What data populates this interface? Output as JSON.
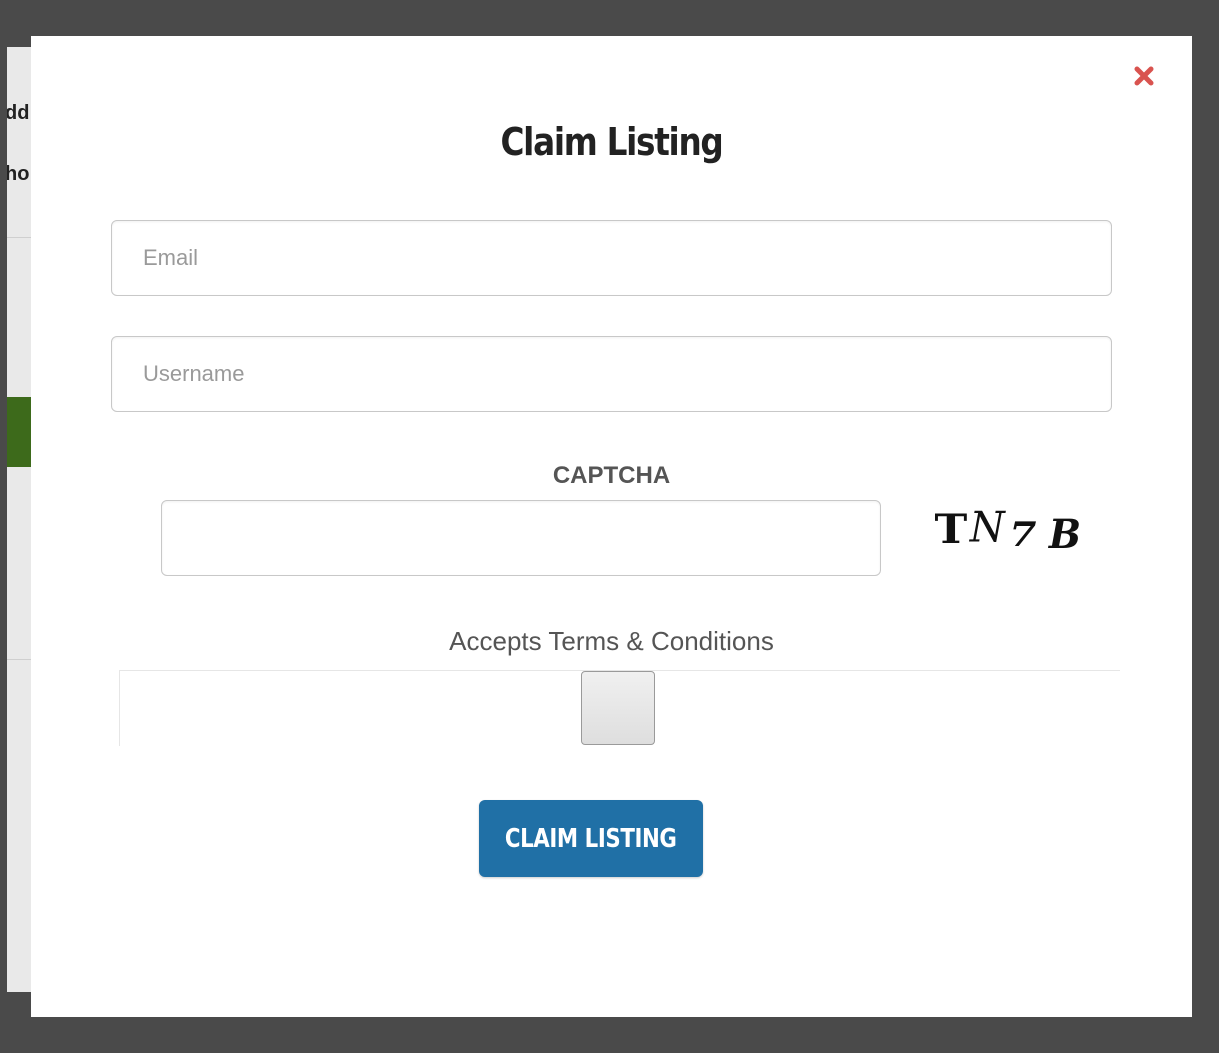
{
  "background": {
    "text_line_1": "dd",
    "text_line_2": "ho",
    "accent_color": "#3d6a1b"
  },
  "modal": {
    "close_icon": "close-icon",
    "close_icon_color": "#d9534f",
    "title": "Claim Listing",
    "email": {
      "placeholder": "Email",
      "value": ""
    },
    "username": {
      "placeholder": "Username",
      "value": ""
    },
    "captcha": {
      "label": "CAPTCHA",
      "value": "",
      "image_text": [
        "T",
        "N",
        "7",
        "B"
      ]
    },
    "terms": {
      "label": "Accepts Terms & Conditions",
      "checked": false
    },
    "submit_label": "CLAIM LISTING",
    "submit_color": "#2070a6"
  }
}
